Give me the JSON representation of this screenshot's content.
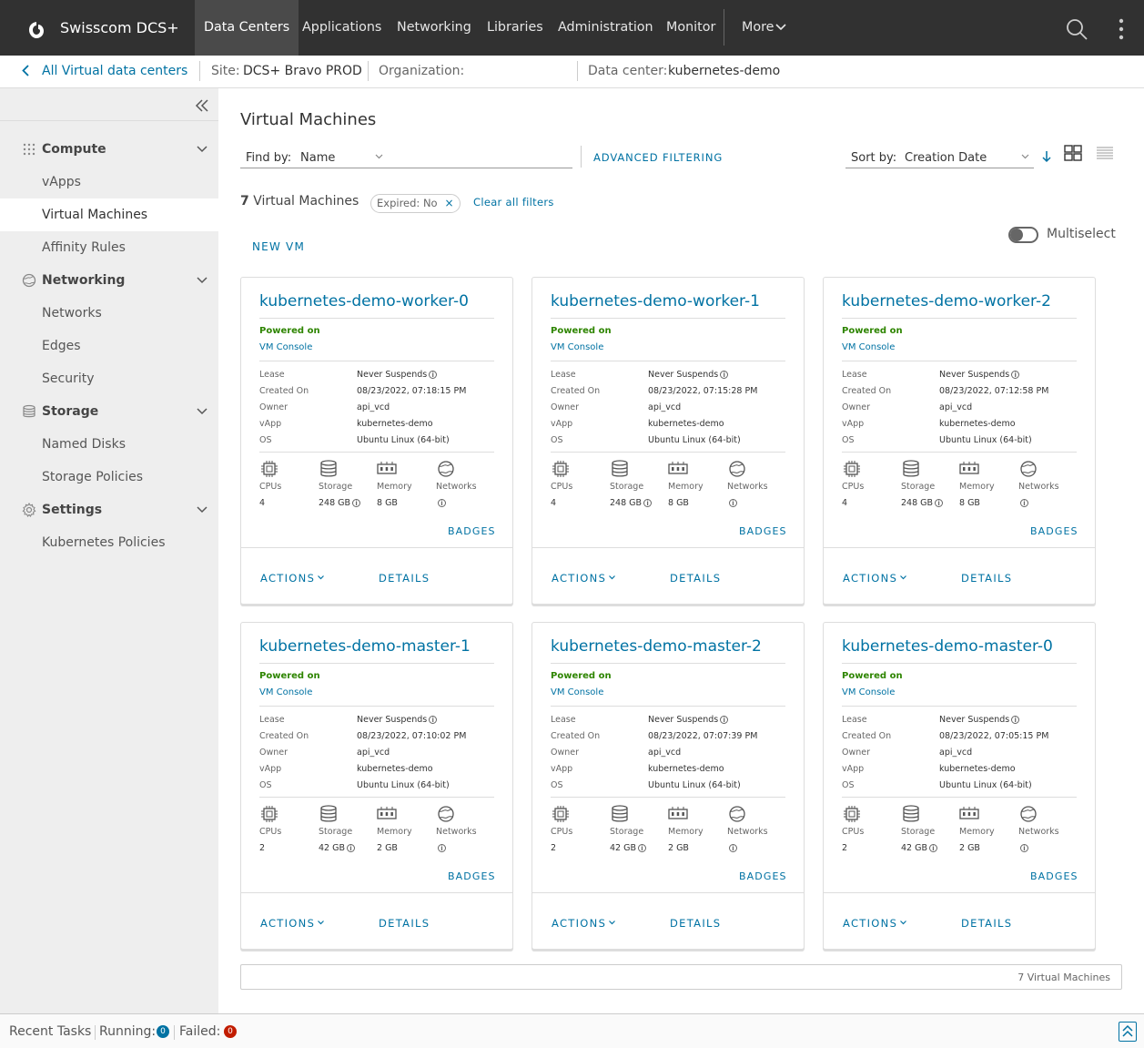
{
  "header": {
    "brand": "Swisscom DCS+",
    "nav": [
      "Data Centers",
      "Applications",
      "Networking",
      "Libraries",
      "Administration",
      "Monitor"
    ],
    "more": "More"
  },
  "context": {
    "back": "All Virtual data centers",
    "site_label": "Site:",
    "site_value": "DCS+ Bravo PROD",
    "org_label": "Organization:",
    "org_value": "",
    "dc_label": "Data center:",
    "dc_value": "kubernetes-demo"
  },
  "sidebar": {
    "groups": [
      {
        "label": "Compute",
        "icon": "grid-icon"
      },
      {
        "label": "Networking",
        "icon": "network-icon"
      },
      {
        "label": "Storage",
        "icon": "storage-icon"
      },
      {
        "label": "Settings",
        "icon": "gear-icon"
      }
    ],
    "items": [
      "vApps",
      "Virtual Machines",
      "Affinity Rules",
      "Networks",
      "Edges",
      "Security",
      "Named Disks",
      "Storage Policies",
      "Kubernetes Policies"
    ],
    "active_item": "Virtual Machines"
  },
  "main": {
    "title": "Virtual Machines",
    "find_by_label": "Find by:",
    "find_by_value": "Name",
    "advanced_filtering": "ADVANCED FILTERING",
    "sort_by_label": "Sort by:",
    "sort_by_value": "Creation Date",
    "count_number": "7",
    "count_label": "Virtual Machines",
    "filter_chip": "Expired: No",
    "clear_filters": "Clear all filters",
    "multiselect": "Multiselect",
    "new_vm": "NEW VM",
    "footer_count": "7 Virtual Machines"
  },
  "card_labels": {
    "lease": "Lease",
    "created_on": "Created On",
    "owner": "Owner",
    "vapp": "vApp",
    "os": "OS",
    "cpus": "CPUs",
    "storage": "Storage",
    "memory": "Memory",
    "networks": "Networks",
    "badges": "BADGES",
    "actions": "ACTIONS",
    "details": "DETAILS",
    "console": "VM Console",
    "info_glyph": "i"
  },
  "vms": [
    {
      "name": "kubernetes-demo-worker-0",
      "status": "Powered on",
      "lease": "Never Suspends",
      "created": "08/23/2022, 07:18:15 PM",
      "owner": "api_vcd",
      "vapp": "kubernetes-demo",
      "os": "Ubuntu Linux (64-bit)",
      "cpus": "4",
      "storage": "248 GB",
      "memory": "8 GB"
    },
    {
      "name": "kubernetes-demo-worker-1",
      "status": "Powered on",
      "lease": "Never Suspends",
      "created": "08/23/2022, 07:15:28 PM",
      "owner": "api_vcd",
      "vapp": "kubernetes-demo",
      "os": "Ubuntu Linux (64-bit)",
      "cpus": "4",
      "storage": "248 GB",
      "memory": "8 GB"
    },
    {
      "name": "kubernetes-demo-worker-2",
      "status": "Powered on",
      "lease": "Never Suspends",
      "created": "08/23/2022, 07:12:58 PM",
      "owner": "api_vcd",
      "vapp": "kubernetes-demo",
      "os": "Ubuntu Linux (64-bit)",
      "cpus": "4",
      "storage": "248 GB",
      "memory": "8 GB"
    },
    {
      "name": "kubernetes-demo-master-1",
      "status": "Powered on",
      "lease": "Never Suspends",
      "created": "08/23/2022, 07:10:02 PM",
      "owner": "api_vcd",
      "vapp": "kubernetes-demo",
      "os": "Ubuntu Linux (64-bit)",
      "cpus": "2",
      "storage": "42 GB",
      "memory": "2 GB"
    },
    {
      "name": "kubernetes-demo-master-2",
      "status": "Powered on",
      "lease": "Never Suspends",
      "created": "08/23/2022, 07:07:39 PM",
      "owner": "api_vcd",
      "vapp": "kubernetes-demo",
      "os": "Ubuntu Linux (64-bit)",
      "cpus": "2",
      "storage": "42 GB",
      "memory": "2 GB"
    },
    {
      "name": "kubernetes-demo-master-0",
      "status": "Powered on",
      "lease": "Never Suspends",
      "created": "08/23/2022, 07:05:15 PM",
      "owner": "api_vcd",
      "vapp": "kubernetes-demo",
      "os": "Ubuntu Linux (64-bit)",
      "cpus": "2",
      "storage": "42 GB",
      "memory": "2 GB"
    }
  ],
  "bottom": {
    "recent_tasks": "Recent Tasks",
    "running_label": "Running:",
    "running_count": "0",
    "failed_label": "Failed:",
    "failed_count": "0"
  },
  "colors": {
    "accent": "#0072a3",
    "header_bg": "#313131",
    "powered_on": "#2e8500",
    "running_pill": "#0072a3",
    "failed_pill": "#c21d00"
  }
}
